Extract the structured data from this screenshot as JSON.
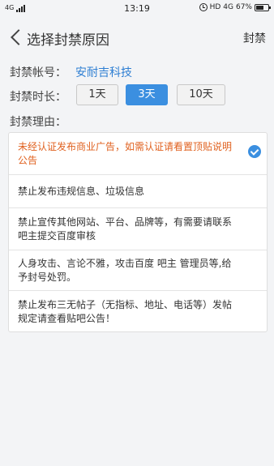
{
  "status_bar": {
    "network": "4G",
    "time": "13:19",
    "hd_label": "HD",
    "net_right": "4G",
    "battery": "67%",
    "battery_level": 0.67
  },
  "header": {
    "title": "选择封禁原因",
    "action_label": "封禁"
  },
  "account": {
    "label": "封禁帐号：",
    "value": "安耐吉科技"
  },
  "duration": {
    "label": "封禁时长：",
    "options": [
      "1天",
      "3天",
      "10天"
    ],
    "selected": "3天"
  },
  "reason": {
    "label": "封禁理由：",
    "items": [
      {
        "text": "未经认证发布商业广告，如需认证请看置顶贴说明公告",
        "selected": true
      },
      {
        "text": "禁止发布违规信息、垃圾信息",
        "selected": false
      },
      {
        "text": "禁止宣传其他网站、平台、品牌等，有需要请联系吧主提交百度审核",
        "selected": false
      },
      {
        "text": "人身攻击、言论不雅，攻击百度 吧主 管理员等,给予封号处罚。",
        "selected": false
      },
      {
        "text": "禁止发布三无帖子（无指标、地址、电话等）发帖规定请查看贴吧公告！",
        "selected": false
      }
    ]
  },
  "colors": {
    "accent": "#3b8fe0",
    "link": "#2f7fd3",
    "selected_text": "#e0611f"
  }
}
